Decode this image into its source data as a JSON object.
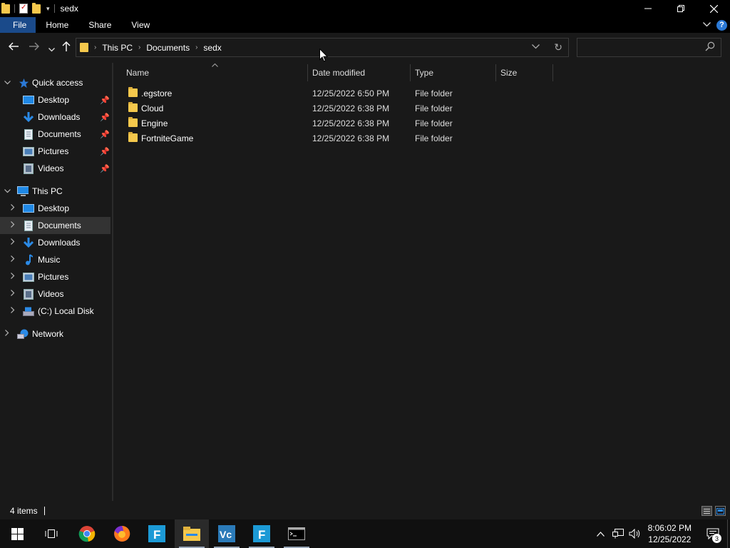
{
  "window": {
    "title": "sedx",
    "controls": [
      "minimize-icon",
      "restore-icon",
      "close-icon"
    ]
  },
  "ribbon": {
    "tabs": [
      "File",
      "Home",
      "Share",
      "View"
    ],
    "help_label": "?"
  },
  "navigation": {
    "back_icon": "arrow-left-icon",
    "forward_icon": "arrow-right-icon",
    "recent_icon": "chevron-down-icon",
    "up_icon": "arrow-up-icon"
  },
  "address": {
    "breadcrumbs": [
      "This PC",
      "Documents",
      "sedx"
    ],
    "refresh_icon": "refresh-icon"
  },
  "search": {
    "placeholder": "",
    "value": ""
  },
  "nav_pane": {
    "quick_access": {
      "label": "Quick access",
      "items": [
        {
          "label": "Desktop",
          "icon": "desktop-icon",
          "pinned": true
        },
        {
          "label": "Downloads",
          "icon": "downloads-icon",
          "pinned": true
        },
        {
          "label": "Documents",
          "icon": "documents-icon",
          "pinned": true
        },
        {
          "label": "Pictures",
          "icon": "pictures-icon",
          "pinned": true
        },
        {
          "label": "Videos",
          "icon": "videos-icon",
          "pinned": true
        }
      ]
    },
    "this_pc": {
      "label": "This PC",
      "items": [
        {
          "label": "Desktop",
          "icon": "desktop-icon"
        },
        {
          "label": "Documents",
          "icon": "documents-icon",
          "selected": true
        },
        {
          "label": "Downloads",
          "icon": "downloads-icon"
        },
        {
          "label": "Music",
          "icon": "music-icon"
        },
        {
          "label": "Pictures",
          "icon": "pictures-icon"
        },
        {
          "label": "Videos",
          "icon": "videos-icon"
        },
        {
          "label": "(C:) Local Disk",
          "icon": "drive-icon"
        }
      ]
    },
    "network": {
      "label": "Network"
    }
  },
  "file_list": {
    "columns": [
      "Name",
      "Date modified",
      "Type",
      "Size"
    ],
    "rows": [
      {
        "name": ".egstore",
        "date": "12/25/2022 6:50 PM",
        "type": "File folder",
        "size": ""
      },
      {
        "name": "Cloud",
        "date": "12/25/2022 6:38 PM",
        "type": "File folder",
        "size": ""
      },
      {
        "name": "Engine",
        "date": "12/25/2022 6:38 PM",
        "type": "File folder",
        "size": ""
      },
      {
        "name": "FortniteGame",
        "date": "12/25/2022 6:38 PM",
        "type": "File folder",
        "size": ""
      }
    ]
  },
  "status": {
    "count": "4 items"
  },
  "taskbar": {
    "apps": [
      "windows-start-icon",
      "task-view-icon",
      "chrome-icon",
      "firefox-icon",
      "fortnite-icon",
      "file-explorer-icon",
      "vmware-icon",
      "fortnite-icon",
      "terminal-icon"
    ],
    "clock_time": "8:06:02 PM",
    "clock_date": "12/25/2022",
    "notification_count": "3"
  },
  "colors": {
    "background": "#191919",
    "titlebar": "#000000",
    "file_tab": "#1a4a8a",
    "folder": "#f5c84c",
    "selection": "#333333",
    "accent": "#2b79d6"
  }
}
